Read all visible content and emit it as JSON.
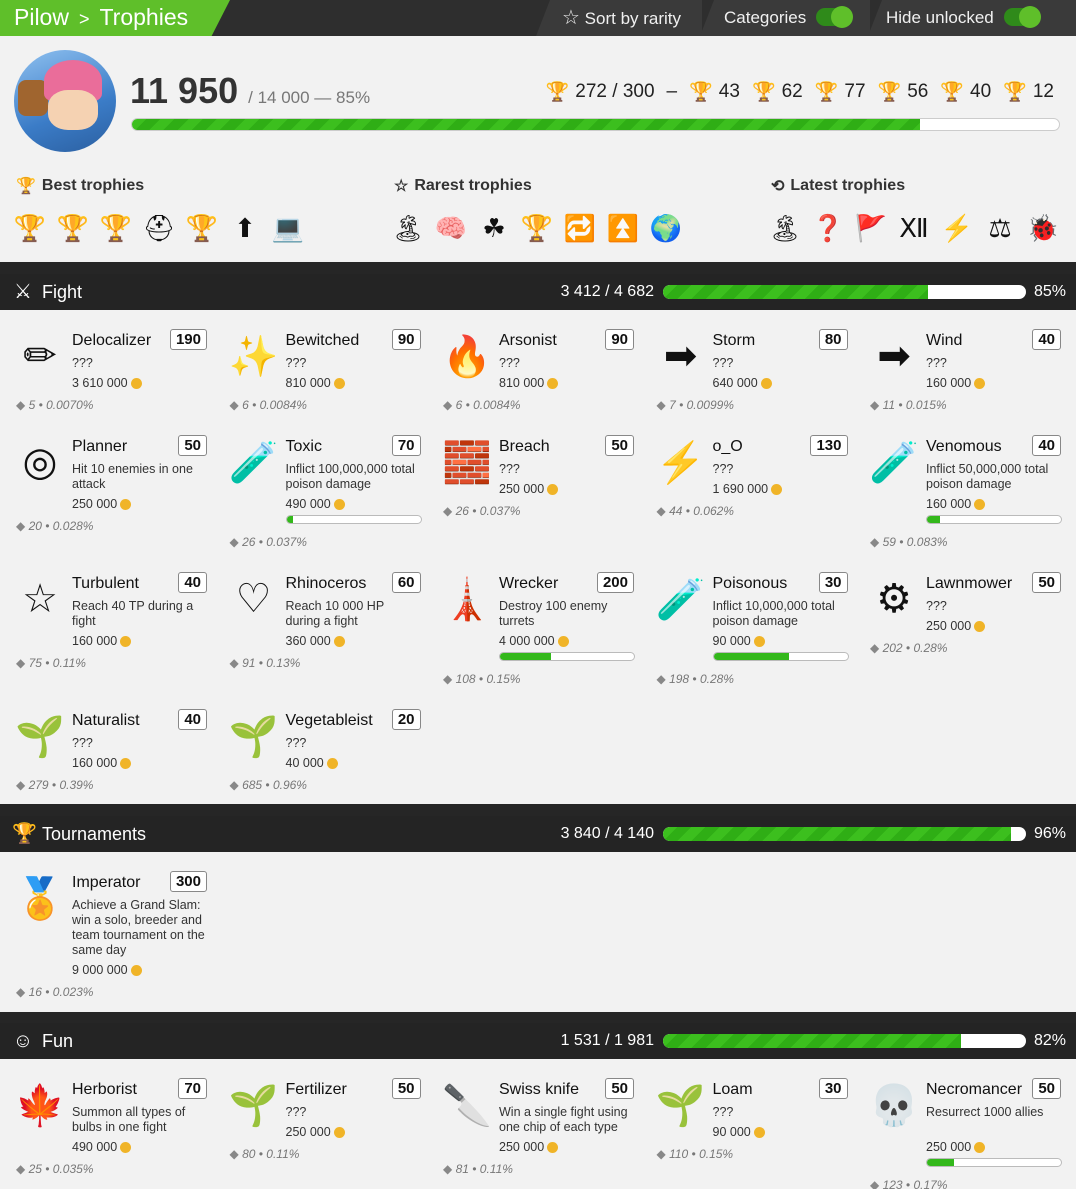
{
  "topbar": {
    "crumb_root": "Pilow",
    "crumb_sep": ">",
    "crumb_page": "Trophies",
    "sort_label": "Sort by rarity",
    "categories_label": "Categories",
    "hide_label": "Hide unlocked"
  },
  "profile": {
    "score": "11 950",
    "score_detail": "/ 14 000 — 85%",
    "progress": 0.85,
    "counts": {
      "total": "272 / 300",
      "dash": "–",
      "grey": "43",
      "green": "62",
      "blue": "77",
      "purple": "56",
      "gold": "40",
      "red": "12"
    },
    "best_title": "Best trophies",
    "rarest_title": "Rarest trophies",
    "latest_title": "Latest trophies",
    "best_icons": [
      "🏆",
      "🏆",
      "🏆",
      "⛑",
      "🏆",
      "⬆",
      "💻"
    ],
    "rarest_icons": [
      "🏝",
      "🧠",
      "☘",
      "🏆",
      "🔁",
      "⏫",
      "🌍"
    ],
    "latest_icons": [
      "🏝",
      "❓",
      "🚩",
      "Ⅻ",
      "⚡",
      "⚖",
      "🐞"
    ]
  },
  "fight": {
    "name": "Fight",
    "frac": "3 412 / 4 682",
    "pct": "85%",
    "progress": 0.73,
    "cards": [
      {
        "icon": "✏",
        "title": "Delocalizer",
        "pts": "190",
        "desc": "???",
        "reward": "3 610 000",
        "stat": "5 • 0.0070%"
      },
      {
        "icon": "✨",
        "title": "Bewitched",
        "pts": "90",
        "desc": "???",
        "reward": "810 000",
        "stat": "6 • 0.0084%"
      },
      {
        "icon": "🔥",
        "title": "Arsonist",
        "pts": "90",
        "desc": "???",
        "reward": "810 000",
        "stat": "6 • 0.0084%"
      },
      {
        "icon": "➡",
        "title": "Storm",
        "pts": "80",
        "desc": "???",
        "reward": "640 000",
        "stat": "7 • 0.0099%"
      },
      {
        "icon": "➡",
        "title": "Wind",
        "pts": "40",
        "desc": "???",
        "reward": "160 000",
        "stat": "11 • 0.015%"
      },
      {
        "icon": "◎",
        "title": "Planner",
        "pts": "50",
        "desc": "Hit 10 enemies in one attack",
        "reward": "250 000",
        "stat": "20 • 0.028%"
      },
      {
        "icon": "🧪",
        "title": "Toxic",
        "pts": "70",
        "desc": "Inflict 100,000,000 total poison damage",
        "reward": "490 000",
        "stat": "26 • 0.037%",
        "progress": 0.05
      },
      {
        "icon": "🧱",
        "title": "Breach",
        "pts": "50",
        "desc": "???",
        "reward": "250 000",
        "stat": "26 • 0.037%"
      },
      {
        "icon": "⚡",
        "title": "o_O",
        "pts": "130",
        "desc": "???",
        "reward": "1 690 000",
        "stat": "44 • 0.062%"
      },
      {
        "icon": "🧪",
        "title": "Venomous",
        "pts": "40",
        "desc": "Inflict 50,000,000 total poison damage",
        "reward": "160 000",
        "stat": "59 • 0.083%",
        "progress": 0.1
      },
      {
        "icon": "☆",
        "title": "Turbulent",
        "pts": "40",
        "desc": "Reach 40 TP during a fight",
        "reward": "160 000",
        "stat": "75 • 0.11%"
      },
      {
        "icon": "♡",
        "title": "Rhinoceros",
        "pts": "60",
        "desc": "Reach 10 000 HP during a fight",
        "reward": "360 000",
        "stat": "91 • 0.13%"
      },
      {
        "icon": "🗼",
        "title": "Wrecker",
        "pts": "200",
        "desc": "Destroy 100 enemy turrets",
        "reward": "4 000 000",
        "stat": "108 • 0.15%",
        "progress": 0.38
      },
      {
        "icon": "🧪",
        "title": "Poisonous",
        "pts": "30",
        "desc": "Inflict 10,000,000 total poison damage",
        "reward": "90 000",
        "stat": "198 • 0.28%",
        "progress": 0.56
      },
      {
        "icon": "⚙",
        "title": "Lawnmower",
        "pts": "50",
        "desc": "???",
        "reward": "250 000",
        "stat": "202 • 0.28%"
      },
      {
        "icon": "🌱",
        "title": "Naturalist",
        "pts": "40",
        "desc": "???",
        "reward": "160 000",
        "stat": "279 • 0.39%"
      },
      {
        "icon": "🌱",
        "title": "Vegetableist",
        "pts": "20",
        "desc": "???",
        "reward": "40 000",
        "stat": "685 • 0.96%"
      }
    ]
  },
  "tournaments": {
    "name": "Tournaments",
    "frac": "3 840 / 4 140",
    "pct": "96%",
    "progress": 0.96,
    "cards": [
      {
        "icon": "🏅",
        "title": "Imperator",
        "pts": "300",
        "desc": "Achieve a Grand Slam: win a solo, breeder and team tournament on the same day",
        "reward": "9 000 000",
        "stat": "16 • 0.023%"
      }
    ]
  },
  "fun": {
    "name": "Fun",
    "frac": "1 531 / 1 981",
    "pct": "82%",
    "progress": 0.82,
    "cards": [
      {
        "icon": "🍁",
        "title": "Herborist",
        "pts": "70",
        "desc": "Summon all types of bulbs in one fight",
        "reward": "490 000",
        "stat": "25 • 0.035%"
      },
      {
        "icon": "🌱",
        "title": "Fertilizer",
        "pts": "50",
        "desc": "???",
        "reward": "250 000",
        "stat": "80 • 0.11%"
      },
      {
        "icon": "🔪",
        "title": "Swiss knife",
        "pts": "50",
        "desc": "Win a single fight using one chip of each type",
        "reward": "250 000",
        "stat": "81 • 0.11%"
      },
      {
        "icon": "🌱",
        "title": "Loam",
        "pts": "30",
        "desc": "???",
        "reward": "90 000",
        "stat": "110 • 0.15%"
      },
      {
        "icon": "💀",
        "title": "Necromancer",
        "pts": "50",
        "desc": "Resurrect 1000 allies",
        "reward": "250 000",
        "stat": "123 • 0.17%",
        "progress": 0.2
      }
    ]
  }
}
